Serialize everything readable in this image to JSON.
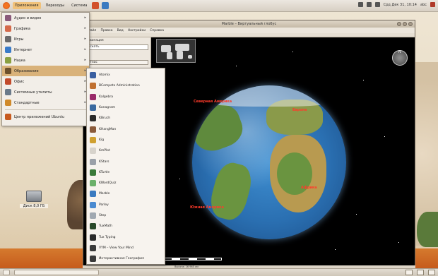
{
  "top_panel": {
    "menus": [
      "Приложения",
      "Переходы",
      "Система"
    ],
    "clock": "Срд Дек 31, 10:14",
    "user": "abc"
  },
  "app_menu": {
    "items": [
      {
        "label": "Аудио и видео",
        "icon": "media-icon",
        "color": "#8a5a7a"
      },
      {
        "label": "Графика",
        "icon": "graphics-icon",
        "color": "#d46a4a"
      },
      {
        "label": "Игры",
        "icon": "games-icon",
        "color": "#6a6a6a"
      },
      {
        "label": "Интернет",
        "icon": "internet-icon",
        "color": "#3a7bc8"
      },
      {
        "label": "Наука",
        "icon": "science-icon",
        "color": "#8aa040"
      },
      {
        "label": "Образование",
        "icon": "education-icon",
        "color": "#6b4f2b"
      },
      {
        "label": "Офис",
        "icon": "office-icon",
        "color": "#c24a2a"
      },
      {
        "label": "Системные утилиты",
        "icon": "system-icon",
        "color": "#6a7a8a"
      },
      {
        "label": "Стандартные",
        "icon": "accessories-icon",
        "color": "#d08a2a"
      },
      {
        "label": "Центр приложений Ubuntu",
        "icon": "software-center-icon",
        "color": "#c75a1e"
      }
    ]
  },
  "sub_menu": {
    "items": [
      {
        "label": "Atomix",
        "icon": "atomix-icon",
        "color": "#3a5fa0"
      },
      {
        "label": "BCompetx Administration",
        "icon": "admin-icon",
        "color": "#c07030"
      },
      {
        "label": "Kalgebra",
        "icon": "kalgebra-icon",
        "color": "#9a2a6a"
      },
      {
        "label": "Kanagram",
        "icon": "kanagram-icon",
        "color": "#3a6aa0"
      },
      {
        "label": "KBruch",
        "icon": "kbruch-icon",
        "color": "#2a2a2a"
      },
      {
        "label": "KHangMan",
        "icon": "khangman-icon",
        "color": "#8a5a3a"
      },
      {
        "label": "Kig",
        "icon": "kig-icon",
        "color": "#d0a030"
      },
      {
        "label": "KmPlot",
        "icon": "kmplot-icon",
        "color": "#d7d3cc"
      },
      {
        "label": "KStars",
        "icon": "kstars-icon",
        "color": "#9aa0a8"
      },
      {
        "label": "KTurtle",
        "icon": "kturtle-icon",
        "color": "#3a7a3a"
      },
      {
        "label": "KWordQuiz",
        "icon": "kwordquiz-icon",
        "color": "#6ab06a"
      },
      {
        "label": "Marble",
        "icon": "marble-icon",
        "color": "#3a7ac0"
      },
      {
        "label": "Parley",
        "icon": "parley-icon",
        "color": "#4a8ad0"
      },
      {
        "label": "Step",
        "icon": "step-icon",
        "color": "#a0a8b0"
      },
      {
        "label": "TuxMath",
        "icon": "tuxmath-icon",
        "color": "#2a4a2a"
      },
      {
        "label": "Tux Typing",
        "icon": "tuxtyping-icon",
        "color": "#2a2a2a"
      },
      {
        "label": "VYM – View Your Mind",
        "icon": "vym-icon",
        "color": "#3a3a3a"
      },
      {
        "label": "Интерактивная География",
        "icon": "geography-icon",
        "color": "#3a3a3a"
      }
    ]
  },
  "window": {
    "title": "Marble – Виртуальный глобус",
    "menubar": [
      "Файл",
      "Правка",
      "Вид",
      "Настройки",
      "Справка"
    ],
    "side_panel": {
      "title": "Навигация",
      "field_value": "Искать",
      "select_value": "Атлас"
    }
  },
  "globe": {
    "labels": [
      {
        "text": "Северная Америка",
        "cls": "city-label"
      },
      {
        "text": "Южная Америка",
        "cls": "city-label"
      },
      {
        "text": "Европа",
        "cls": "city-label"
      },
      {
        "text": "Африка",
        "cls": "city-label"
      }
    ]
  },
  "desktop": {
    "icon_label": "Диск 8,0 ГБ"
  },
  "status": {
    "text": "Высота: 16 965 км"
  }
}
